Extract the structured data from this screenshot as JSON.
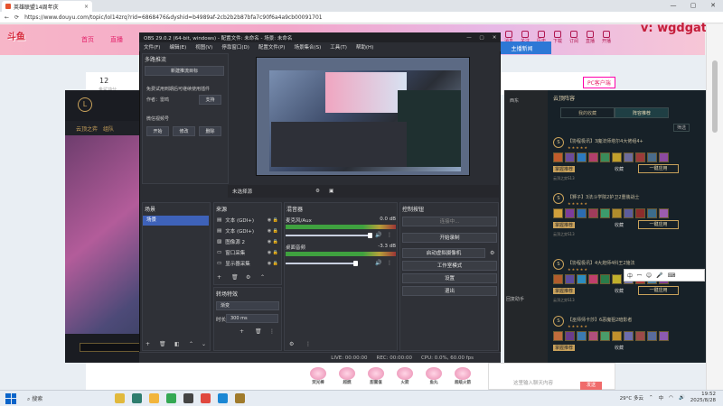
{
  "browser": {
    "tab_title": "英雄联盟14周年庆",
    "url": "https://www.douyu.com/topic/lol14zrq?rid=6868476&dyshid=b4989af-2cb2b2b87bfa7c90f6a4a9cb00091701",
    "win_controls": [
      "—",
      "▢",
      "✕"
    ]
  },
  "site": {
    "logo": "斗鱼",
    "nav": [
      "首页",
      "直播",
      "分类"
    ],
    "right_icons": [
      "消息",
      "关注",
      "历史",
      "下载",
      "订阅",
      "直播",
      "开播"
    ],
    "watermark": "v: wgdgat",
    "strip_num": "12",
    "strip_caption": "金鲨冲分",
    "strip_blue": "主播新闻",
    "pc_client": "PC客户端"
  },
  "game": {
    "topbar": [
      "云顶之弈",
      "组队"
    ],
    "logo": "L"
  },
  "community": {
    "title": "云顶阵容",
    "tabs": [
      "我的收藏",
      "阵容推荐"
    ],
    "filter": "筛选",
    "comps": [
      {
        "rank": "S",
        "title": "【协程极讯】3魔法师塔尔4大佬组4+",
        "tag": "掌握推荐",
        "fav": "收藏",
        "apply": "一键应用",
        "meta": "云顶之弈S13"
      },
      {
        "rank": "S",
        "title": "【狮子】3法斗学院2护卫2重装战士",
        "tag": "掌握推荐",
        "fav": "收藏",
        "apply": "一键应用",
        "meta": "云顶之弈S13"
      },
      {
        "rank": "S",
        "title": "【协程极讯】4大炮师4科王2施法",
        "tag": "掌握推荐",
        "fav": "收藏",
        "apply": "一键应用",
        "meta": "云顶之弈S13"
      },
      {
        "rank": "S",
        "title": "【巫师师卡莎】6恶魔狙2暗影者",
        "tag": "掌握推荐",
        "fav": "收藏",
        "apply": "一键应用",
        "meta": "云顶之弈S13"
      }
    ]
  },
  "mid_panel": {
    "label": "西东",
    "text": "回复助手"
  },
  "obs": {
    "title": "OBS 29.0.2 (64-bit, windows) - 配置文件: 未命名 - 场景: 未命名",
    "menu": [
      "文件(F)",
      "编辑(E)",
      "视图(V)",
      "停靠窗口(D)",
      "配置文件(P)",
      "场景集合(S)",
      "工具(T)",
      "帮助(H)"
    ],
    "plugin": {
      "title": "多路推流",
      "new_target": "新建推流目标",
      "text1": "免费试用到期后可继续使用插件",
      "text2": "作者：雷鸣",
      "support": "支持",
      "text3": "微信视频号",
      "btn_start": "开始",
      "btn_edit": "修改",
      "btn_delete": "删除"
    },
    "subbar": "未选择源",
    "scenes": {
      "title": "场景",
      "items": [
        "场景"
      ]
    },
    "sources": {
      "title": "来源",
      "items": [
        "文本 (GDI+)",
        "文本 (GDI+)",
        "图像源 2",
        "窗口采集",
        "显示器采集"
      ]
    },
    "transitions": {
      "title": "转场特效",
      "type": "渐变",
      "duration_label": "时长",
      "duration": "300 ms"
    },
    "mixer": {
      "title": "混音器",
      "channels": [
        {
          "name": "麦克风/Aux",
          "db": "0.0 dB"
        },
        {
          "name": "桌面音频",
          "db": "-3.3 dB"
        }
      ]
    },
    "controls": {
      "title": "控制按钮",
      "buttons": [
        "连接中...",
        "开始录制",
        "启动虚拟摄像机",
        "工作室模式",
        "设置",
        "退出"
      ]
    },
    "status": {
      "live": "LIVE: 00:00:00",
      "rec": "REC: 00:00:00",
      "cpu": "CPU: 0.0%, 60.00 fps"
    }
  },
  "page_bottom": {
    "chat_placeholder": "这里输入聊天内容",
    "send": "发送",
    "gifts": [
      "荧光棒",
      "超燃",
      "甜蜜值",
      "火箭",
      "鱼丸",
      "超级火箭"
    ]
  },
  "ime": [
    "中",
    "ꟷ",
    "☺",
    "🎤",
    "⌨"
  ],
  "taskbar": {
    "search": "搜索",
    "weather": "29°C 多云",
    "time": "19:52",
    "date": "2025/8/28",
    "lang": "中"
  },
  "colors": {
    "accent": "#3e62b9",
    "brand": "#e4226a"
  }
}
